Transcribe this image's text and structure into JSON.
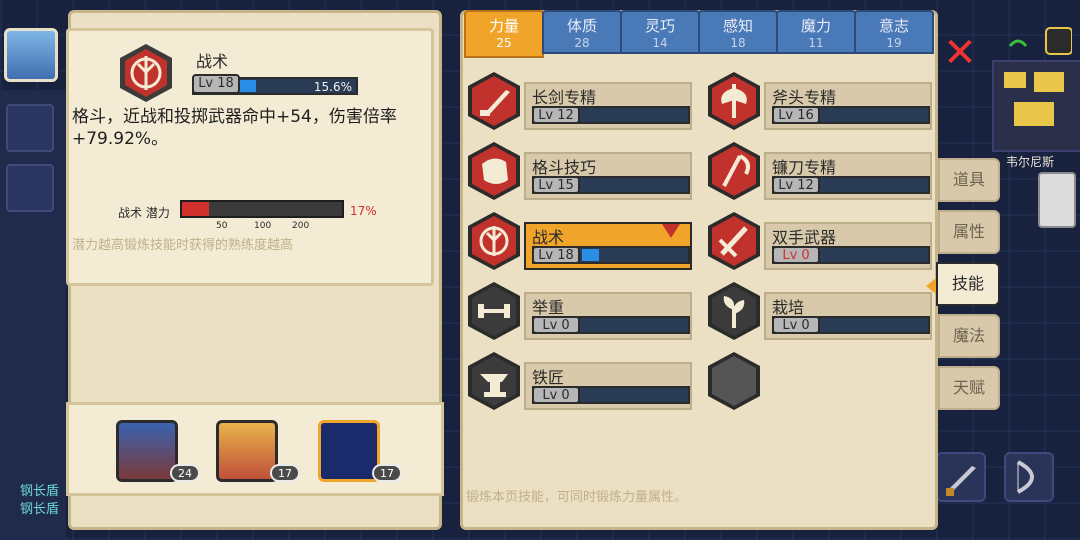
{
  "tabs": [
    {
      "label": "力量",
      "value": "25",
      "active": true
    },
    {
      "label": "体质",
      "value": "28",
      "active": false
    },
    {
      "label": "灵巧",
      "value": "14",
      "active": false
    },
    {
      "label": "感知",
      "value": "18",
      "active": false
    },
    {
      "label": "魔力",
      "value": "11",
      "active": false
    },
    {
      "label": "意志",
      "value": "19",
      "active": false
    }
  ],
  "detail": {
    "title": "战术",
    "level": "Lv 18",
    "progress_pct": "15.6%",
    "progress": 0.156,
    "description": "格斗，近战和投掷武器命中+54，伤害倍率+79.92%。",
    "potential_label": "战术 潜力",
    "potential_pct": "17%",
    "potential": 0.17,
    "ticks": [
      "50",
      "100",
      "200"
    ],
    "hint": "潜力越高锻炼技能时获得的熟练度越高"
  },
  "skills": [
    {
      "name": "长剑专精",
      "level": "Lv 12",
      "progress": 0.0,
      "icon": "sword-icon"
    },
    {
      "name": "斧头专精",
      "level": "Lv 16",
      "progress": 0.0,
      "icon": "axe-icon"
    },
    {
      "name": "格斗技巧",
      "level": "Lv 15",
      "progress": 0.0,
      "icon": "fist-icon"
    },
    {
      "name": "镰刀专精",
      "level": "Lv 12",
      "progress": 0.0,
      "icon": "scythe-icon"
    },
    {
      "name": "战术",
      "level": "Lv 18",
      "progress": 0.156,
      "icon": "tactics-icon",
      "selected": true
    },
    {
      "name": "双手武器",
      "level": "Lv 0",
      "progress": 0.0,
      "icon": "two-hand-icon",
      "red_level": true
    },
    {
      "name": "举重",
      "level": "Lv 0",
      "progress": 0.0,
      "icon": "dumbbell-icon"
    },
    {
      "name": "栽培",
      "level": "Lv 0",
      "progress": 0.0,
      "icon": "plant-icon"
    },
    {
      "name": "铁匠",
      "level": "Lv 0",
      "progress": 0.0,
      "icon": "anvil-icon"
    }
  ],
  "footnote": "锻炼本页技能，可同时锻炼力量属性。",
  "side_tabs": [
    {
      "label": "道具",
      "active": false
    },
    {
      "label": "属性",
      "active": false
    },
    {
      "label": "技能",
      "active": true
    },
    {
      "label": "魔法",
      "active": false
    },
    {
      "label": "天赋",
      "active": false
    }
  ],
  "team": [
    {
      "level": "24"
    },
    {
      "level": "17"
    },
    {
      "level": "17"
    }
  ],
  "hud": {
    "minimap_label": "韦尔尼斯",
    "left_names": [
      "钢长盾",
      "钢长盾"
    ]
  },
  "colors": {
    "accent": "#f0a52a",
    "hex_red": "#c1322d",
    "hex_dark": "#3b3b3b",
    "bar_blue": "#2a8ee6",
    "potential_red": "#d0312d"
  }
}
